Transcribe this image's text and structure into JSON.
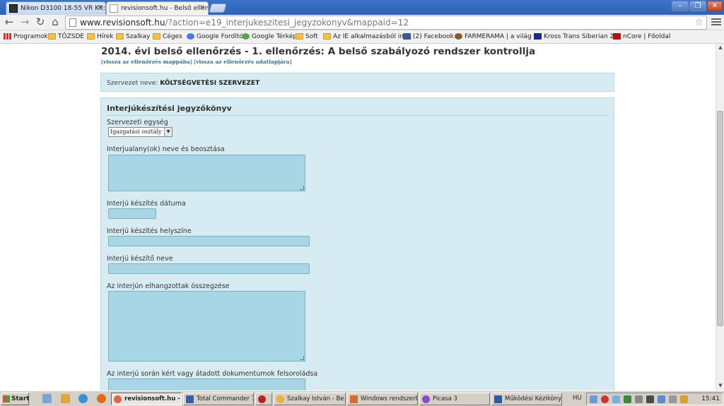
{
  "tabs": [
    {
      "title": "Nikon D3100 18-55 VR Kit: \"j"
    },
    {
      "title": "revisionsoft.hu - Belső ellen"
    }
  ],
  "address": {
    "host": "www.revisionsoft.hu",
    "rest": "/?action=e19_interjukeszitesi_jegyzokonyv&mappaid=12"
  },
  "bookmarks": [
    {
      "label": "Programok",
      "icon": "apps-icon"
    },
    {
      "label": "TŐZSDE",
      "icon": "folder-icon"
    },
    {
      "label": "Hírek",
      "icon": "folder-icon"
    },
    {
      "label": "Szalkay",
      "icon": "folder-icon"
    },
    {
      "label": "Céges",
      "icon": "folder-icon"
    },
    {
      "label": "Google Fordító",
      "icon": "google-translate-icon"
    },
    {
      "label": "Google Térkép",
      "icon": "google-maps-icon"
    },
    {
      "label": "Soft",
      "icon": "folder-icon"
    },
    {
      "label": "Az IE alkalmazásból im...",
      "icon": "folder-icon"
    },
    {
      "label": "(2) Facebook",
      "icon": "facebook-icon"
    },
    {
      "label": "FARMERAMA | a világ ...",
      "icon": "farmerama-icon"
    },
    {
      "label": "Kross Trans Siberian 2...",
      "icon": "kross-icon"
    },
    {
      "label": "nCore | Főoldal",
      "icon": "ncore-icon"
    }
  ],
  "page": {
    "title": "2014. évi belső ellenőrzés - 1. ellenőrzés: A belső szabályozó rendszer kontrollja",
    "link1": "vissza az ellenőrzés mappába",
    "link2": "vissza az ellenőrzés adatlapjára",
    "org_label": "Szervezet neve:",
    "org_value": "KÖLTSÉGVETÉSI SZERVEZET",
    "form_title": "Interjúkészítési jegyzőkönyv",
    "fields": {
      "unit_label": "Szervezeti egység",
      "unit_value": "Igazgatási osztály",
      "interviewees_label": "Interjualany(ok) neve és beosztása",
      "date_label": "Interjú készítés dátuma",
      "place_label": "Interjú készítés helyszíne",
      "interviewer_label": "Interjú készítő neve",
      "summary_label": "Az interjún elhangzottak összegzése",
      "documents_label": "Az interjú során kért vagy átadott dokumentumok felsoroládsa"
    }
  },
  "taskbar": {
    "start": "Start",
    "items": [
      {
        "label": "revisionsoft.hu - ...",
        "active": true
      },
      {
        "label": "Total Commander 7...."
      },
      {
        "label": ""
      },
      {
        "label": "Szalkay István - Be..."
      },
      {
        "label": "Windows rendszerb..."
      },
      {
        "label": "Picasa 3"
      },
      {
        "label": "Működési Kézikönyv..."
      }
    ],
    "lang": "HU",
    "clock": "15:41"
  }
}
